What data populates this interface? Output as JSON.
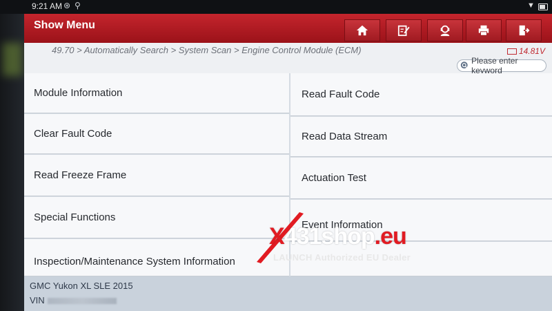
{
  "status_bar": {
    "time": "9:21 AM"
  },
  "header": {
    "title": "Show Menu",
    "buttons": [
      {
        "icon": "home-icon"
      },
      {
        "icon": "edit-report-icon"
      },
      {
        "icon": "user-support-icon"
      },
      {
        "icon": "print-icon"
      },
      {
        "icon": "exit-icon"
      }
    ]
  },
  "breadcrumb": {
    "path": "49.70 > Automatically Search > System Scan > Engine Control Module (ECM)",
    "voltage": "14.81V"
  },
  "search": {
    "placeholder": "Please enter keyword"
  },
  "menu": {
    "left": [
      "Module Information",
      "Clear Fault Code",
      "Read Freeze Frame",
      "Special Functions",
      "Inspection/Maintenance System Information"
    ],
    "right": [
      "Read Fault Code",
      "Read Data Stream",
      "Actuation Test",
      "Event Information",
      ""
    ]
  },
  "footer": {
    "vehicle": "GMC Yukon XL SLE 2015",
    "vin_label": "VIN"
  },
  "watermark": {
    "brand_x": "X",
    "brand_mid": "431shop",
    "brand_tld": ".eu",
    "tagline": "LAUNCH Authorized EU Dealer"
  },
  "colors": {
    "header_red": "#b31c24",
    "accent_red": "#e11b22"
  }
}
